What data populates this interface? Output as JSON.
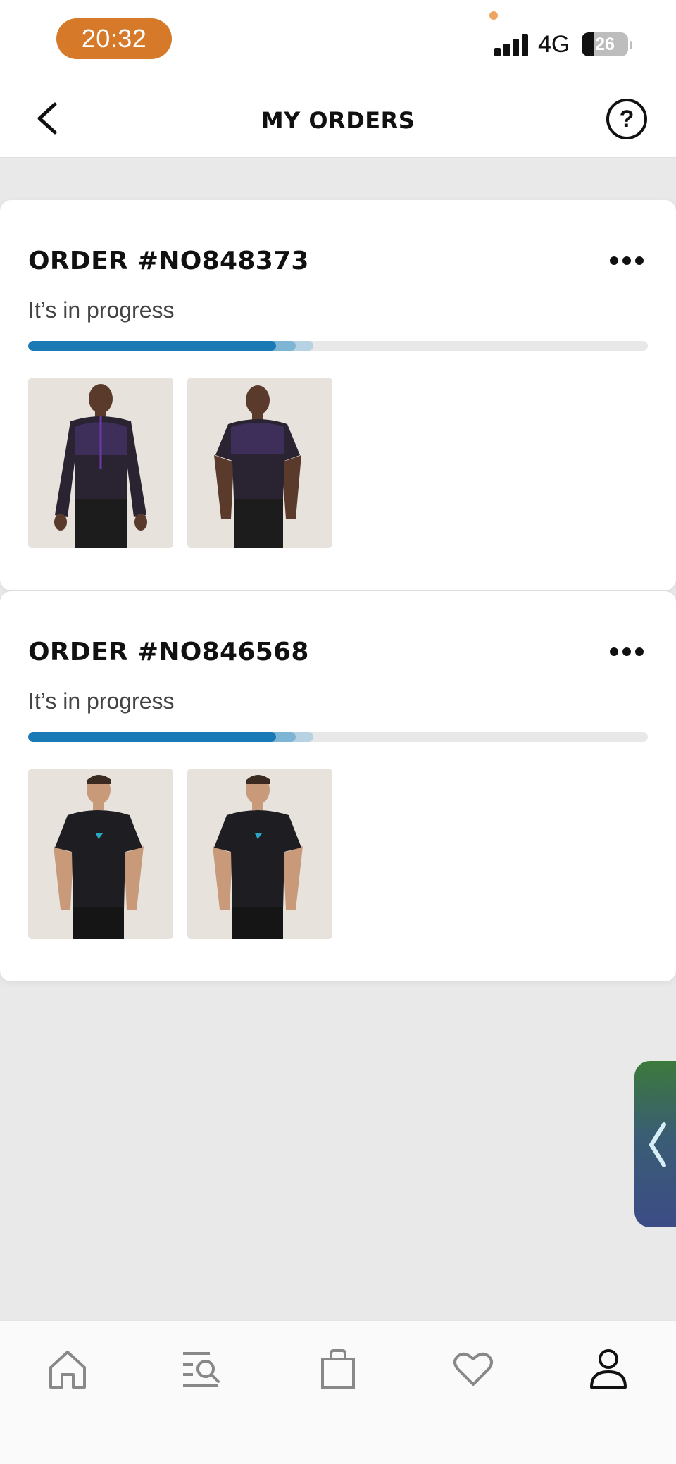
{
  "status_bar": {
    "time": "20:32",
    "network": "4G",
    "battery_level": "26"
  },
  "header": {
    "title": "MY ORDERS",
    "back_icon": "chevron-left-icon",
    "help_icon": "question-circle-icon",
    "help_label": "?"
  },
  "orders": [
    {
      "title": "ORDER #NO848373",
      "status": "It’s in progress",
      "progress": 0.4,
      "items": [
        {
          "icon": "product-photo-long-sleeve-purple-top"
        },
        {
          "icon": "product-photo-short-sleeve-purple-top"
        }
      ]
    },
    {
      "title": "ORDER #NO846568",
      "status": "It’s in progress",
      "progress": 0.4,
      "items": [
        {
          "icon": "product-photo-black-tshirt"
        },
        {
          "icon": "product-photo-black-tshirt"
        }
      ]
    }
  ],
  "side_tab": {
    "icon": "chevron-left-icon"
  },
  "bottom_nav": {
    "items": [
      {
        "icon": "home-icon"
      },
      {
        "icon": "search-list-icon"
      },
      {
        "icon": "shopping-bag-icon"
      },
      {
        "icon": "heart-icon"
      },
      {
        "icon": "profile-icon"
      }
    ]
  },
  "colors": {
    "accent": "#1a7ab5",
    "time_pill": "#d67a2a",
    "background": "#e9e9e9"
  }
}
